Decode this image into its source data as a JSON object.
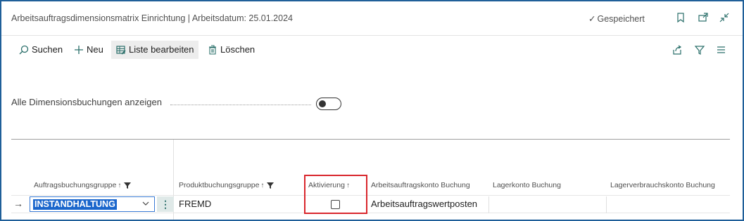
{
  "window": {
    "title": "Arbeitsauftragsdimensionsmatrix Einrichtung | Arbeitsdatum: 25.01.2024",
    "status": "Gespeichert"
  },
  "toolbar": {
    "search_label": "Suchen",
    "new_label": "Neu",
    "edit_list_label": "Liste bearbeiten",
    "delete_label": "Löschen"
  },
  "options": {
    "show_all_label": "Alle Dimensionsbuchungen anzeigen",
    "show_all_value": false
  },
  "table": {
    "columns": [
      {
        "label": "Auftragsbuchungsgruppe",
        "sort": "↑"
      },
      {
        "label": "Produktbuchungsgruppe",
        "sort": "↑"
      },
      {
        "label": "Aktivierung",
        "sort": "↑"
      },
      {
        "label": "Arbeitsauftragskonto Buchung"
      },
      {
        "label": "Lagerkonto Buchung"
      },
      {
        "label": "Lagerverbrauchskonto Buchung"
      }
    ],
    "rows": [
      {
        "order_group": "INSTANDHALTUNG",
        "product_group": "FREMD",
        "activation": false,
        "account_posting": "Arbeitsauftragswertposten",
        "inventory_posting": "",
        "consumption_posting": ""
      }
    ]
  },
  "colors": {
    "frame": "#1f5f99",
    "highlight": "#d9262c",
    "selection": "#1a66cc",
    "accent": "#2a6f6a"
  }
}
